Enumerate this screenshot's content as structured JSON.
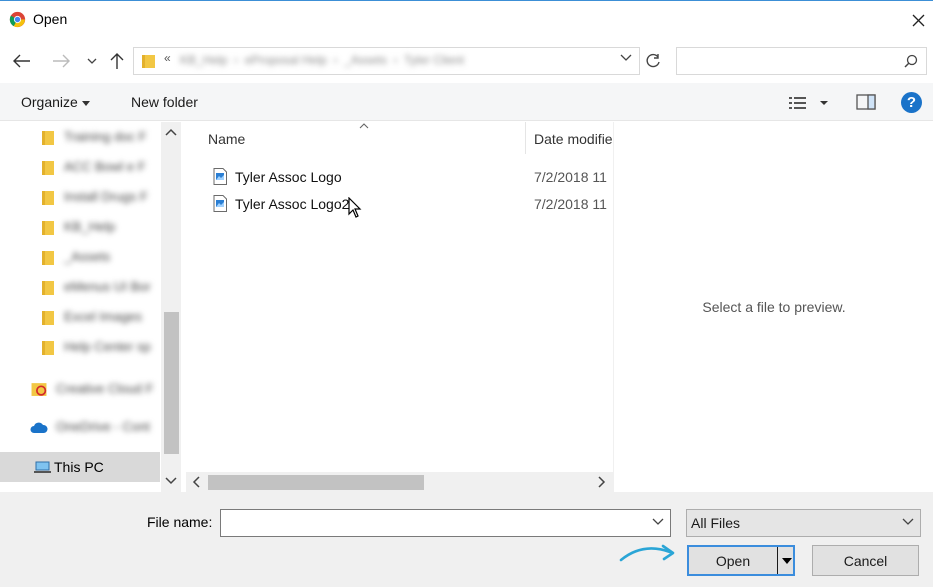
{
  "titlebar": {
    "title": "Open",
    "app_icon": "chrome-icon",
    "close_icon": "close-icon"
  },
  "address": {
    "breadcrumbs": [
      "«",
      "KB_Help",
      "eProposal Help",
      "_Assets",
      "Tyler Client"
    ],
    "search_placeholder": ""
  },
  "toolbar": {
    "organize_label": "Organize",
    "new_folder_label": "New folder"
  },
  "nav": {
    "folders": [
      "Training doc F",
      "ACC Bowl e F",
      "Install Drugs F",
      "KB_Help",
      "_Assets",
      "eMenus UI Bor",
      "Excel Images",
      "Help Center sp"
    ],
    "creative_cloud": "Creative Cloud F",
    "onedrive": "OneDrive - Cont",
    "this_pc": "This PC"
  },
  "columns": {
    "name": "Name",
    "date": "Date modified"
  },
  "files": [
    {
      "name": "Tyler Assoc Logo",
      "date": "7/2/2018 11"
    },
    {
      "name": "Tyler Assoc Logo2",
      "date": "7/2/2018 11"
    }
  ],
  "preview": {
    "message": "Select a file to preview."
  },
  "footer": {
    "file_name_label": "File name:",
    "file_name_value": "",
    "filter_value": "All Files",
    "open_label": "Open",
    "cancel_label": "Cancel"
  },
  "colors": {
    "accent": "#3b8ddd",
    "help": "#1a73c9",
    "folder": "#f2c744"
  }
}
